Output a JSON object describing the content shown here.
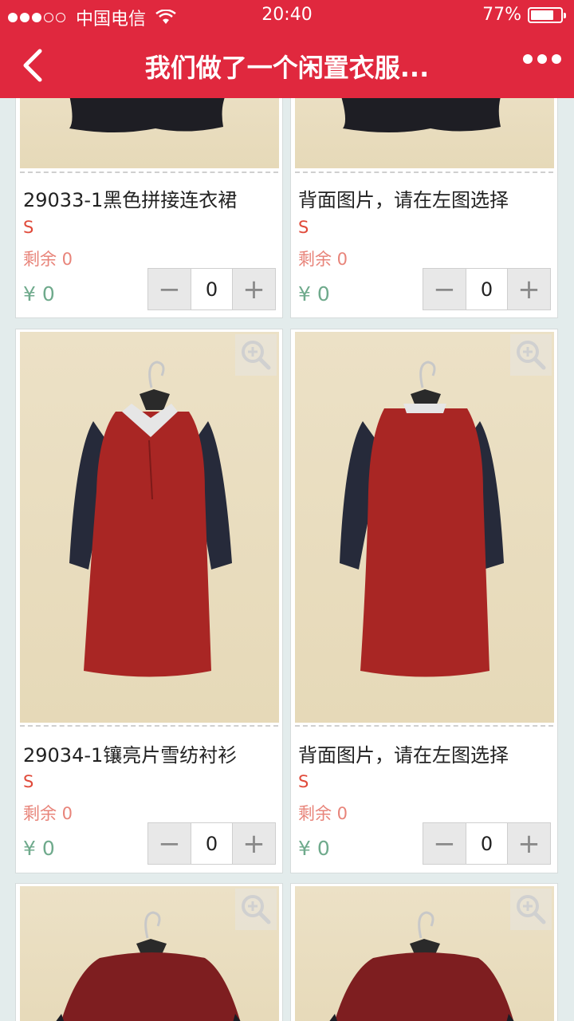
{
  "status": {
    "carrier": "中国电信",
    "time": "20:40",
    "battery": "77%"
  },
  "nav": {
    "title": "我们做了一个闲置衣服..."
  },
  "products": [
    {
      "name": "29033-1黑色拼接连衣裙",
      "size": "S",
      "stock": "剩余 0",
      "price": "¥ 0",
      "qty": "0"
    },
    {
      "name": "背面图片，请在左图选择",
      "size": "S",
      "stock": "剩余 0",
      "price": "¥ 0",
      "qty": "0"
    },
    {
      "name": "29034-1镶亮片雪纺衬衫",
      "size": "S",
      "stock": "剩余 0",
      "price": "¥ 0",
      "qty": "0"
    },
    {
      "name": "背面图片，请在左图选择",
      "size": "S",
      "stock": "剩余 0",
      "price": "¥ 0",
      "qty": "0"
    }
  ],
  "stepper": {
    "minus": "−",
    "plus": "+"
  },
  "colors": {
    "brand_red": "#e0283e",
    "price_green": "#6faa8c",
    "size_red": "#e04a3a"
  }
}
